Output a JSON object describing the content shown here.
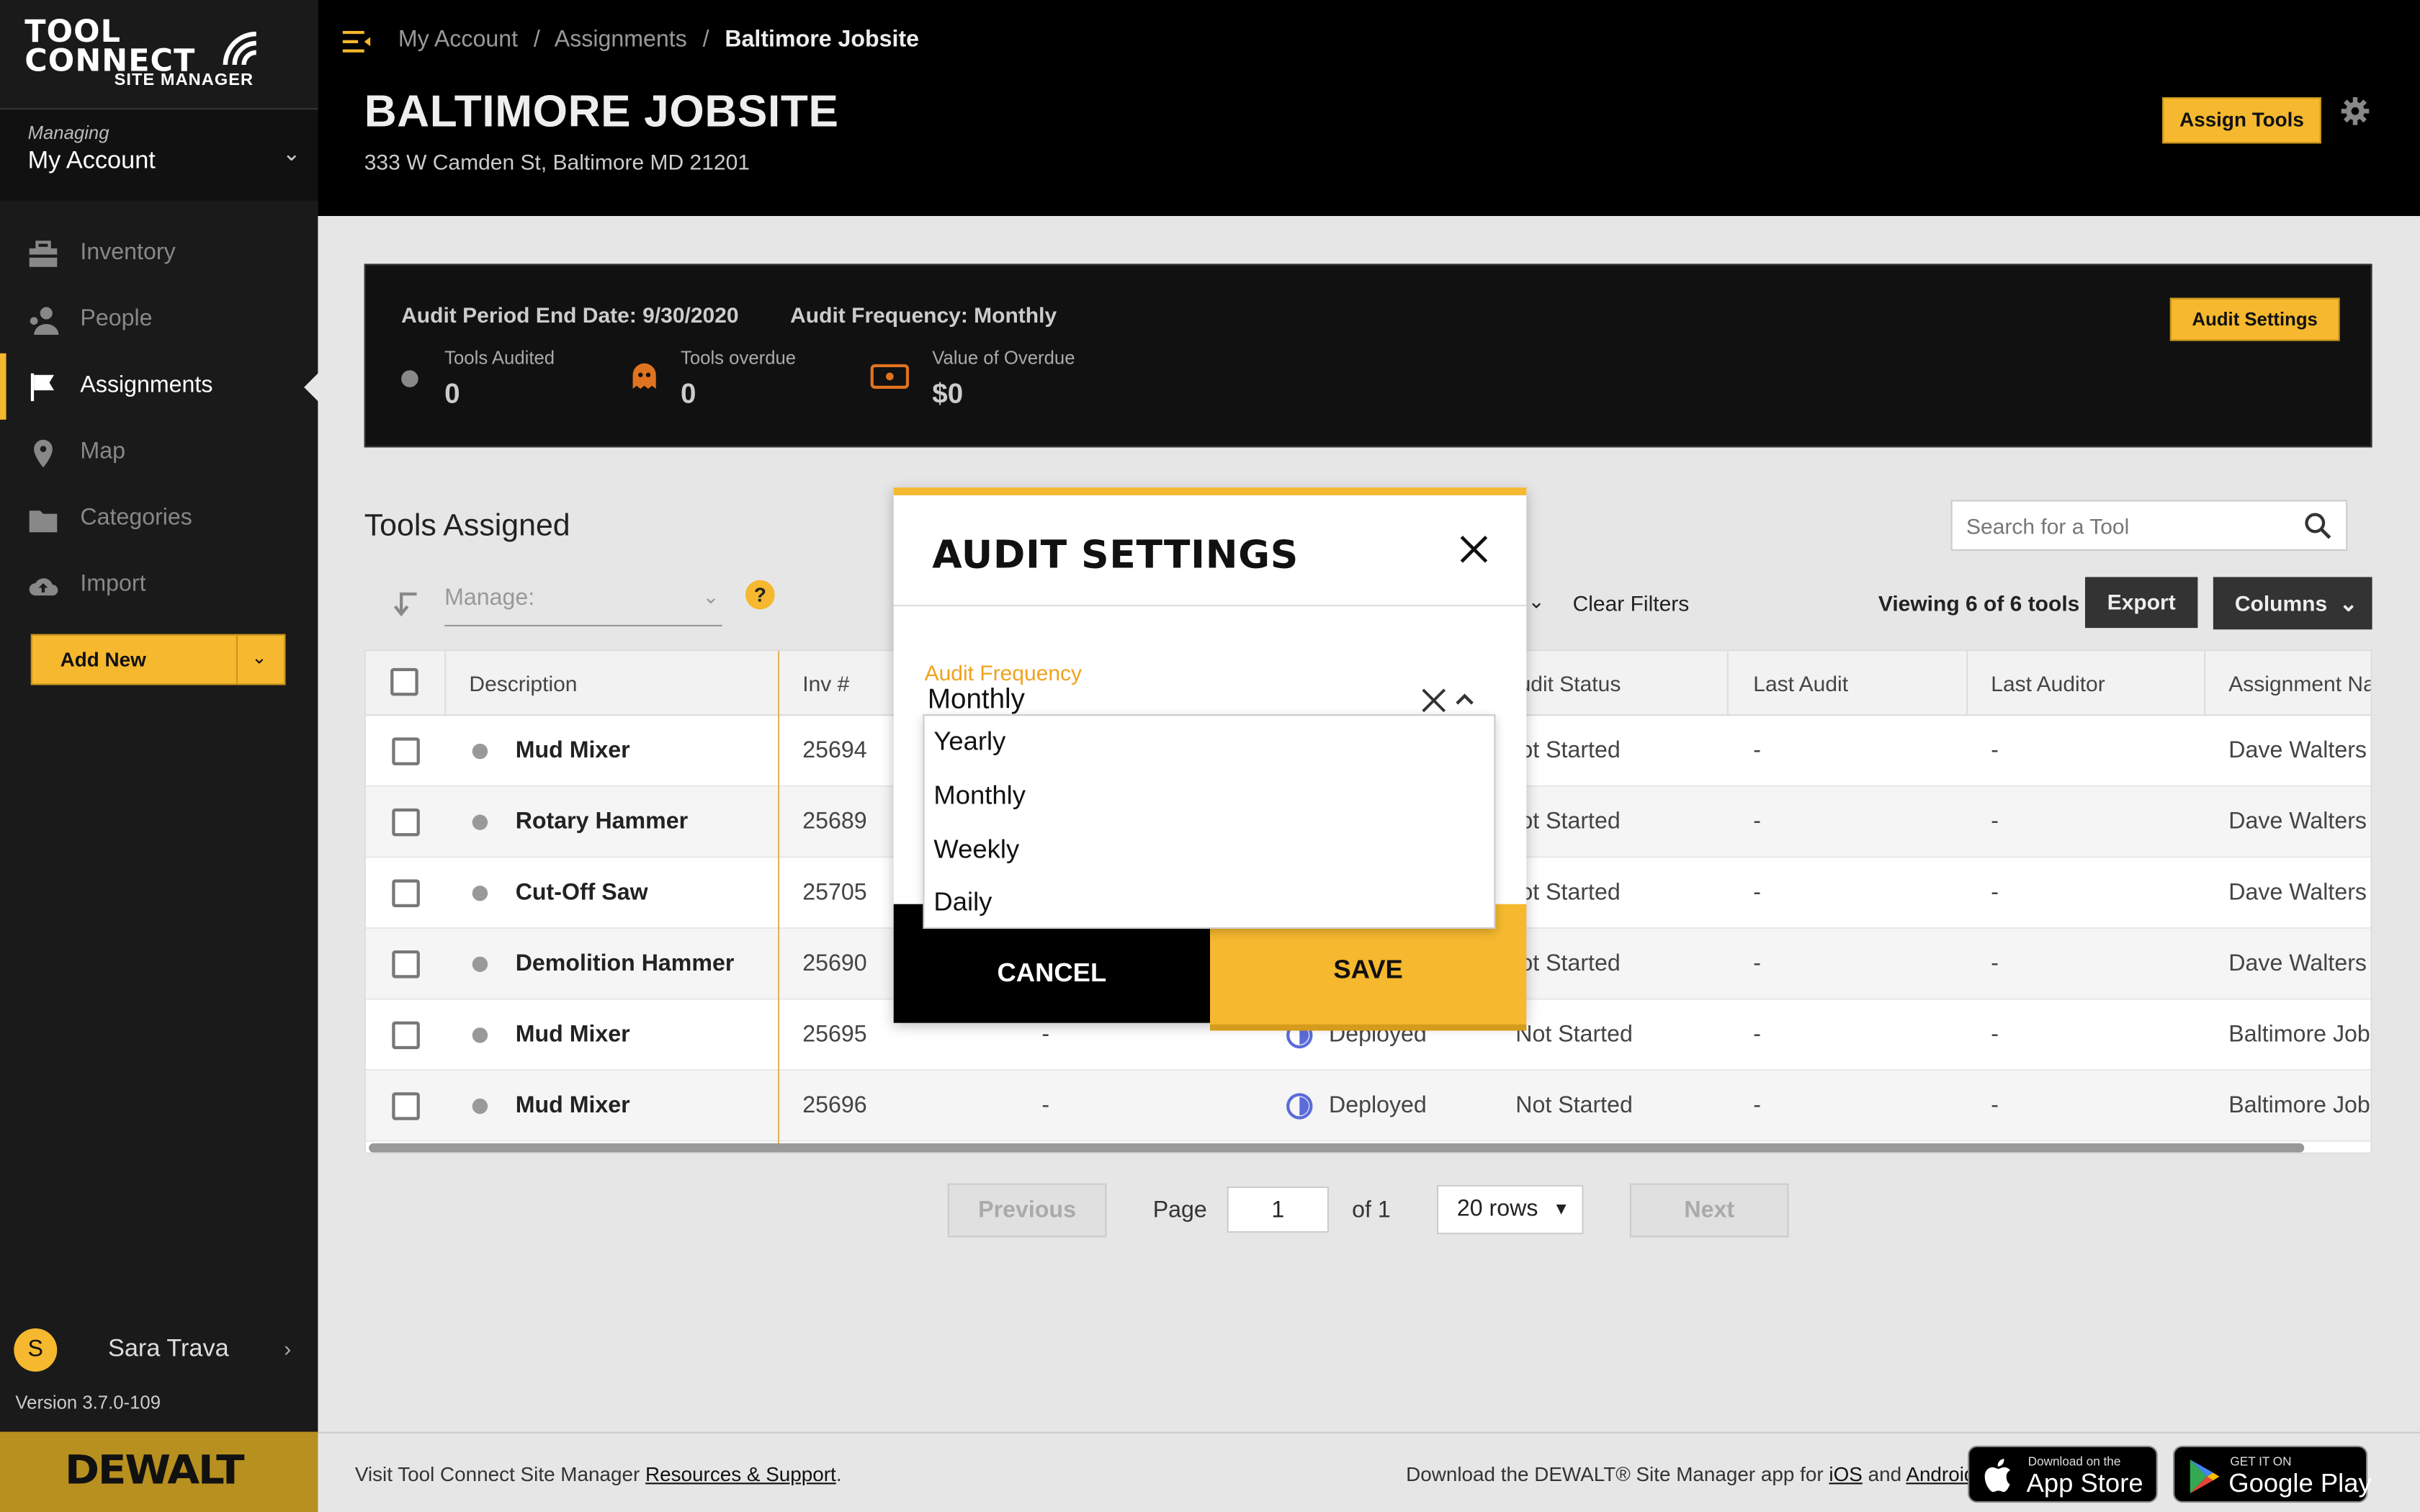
{
  "app": {
    "logo_line1": "TOOL",
    "logo_line2": "CONNECT",
    "logo_line3": "SITE MANAGER",
    "brand": "DEWALT",
    "accent_color": "#f5b82e"
  },
  "sidebar": {
    "managing_label": "Managing",
    "managing_value": "My Account",
    "items": [
      {
        "label": "Inventory",
        "icon": "toolbox-icon",
        "active": false
      },
      {
        "label": "People",
        "icon": "people-icon",
        "active": false
      },
      {
        "label": "Assignments",
        "icon": "flag-icon",
        "active": true
      },
      {
        "label": "Map",
        "icon": "map-pin-icon",
        "active": false
      },
      {
        "label": "Categories",
        "icon": "folder-icon",
        "active": false
      },
      {
        "label": "Import",
        "icon": "cloud-upload-icon",
        "active": false
      }
    ],
    "add_new_label": "Add New",
    "user_initial": "S",
    "user_name": "Sara Trava",
    "version": "Version 3.7.0-109"
  },
  "header": {
    "breadcrumbs": [
      "My Account",
      "Assignments",
      "Baltimore Jobsite"
    ],
    "breadcrumb_sep": "/",
    "title": "BALTIMORE JOBSITE",
    "address": "333 W Camden St, Baltimore MD 21201",
    "assign_tools_label": "Assign Tools"
  },
  "audit": {
    "period_end": "Audit Period End Date: 9/30/2020",
    "frequency": "Audit Frequency: Monthly",
    "settings_label": "Audit Settings",
    "stats": [
      {
        "label": "Tools Audited",
        "value": "0"
      },
      {
        "label": "Tools overdue",
        "value": "0"
      },
      {
        "label": "Value of Overdue",
        "value": "$0"
      }
    ]
  },
  "tools": {
    "heading": "Tools Assigned",
    "search_placeholder": "Search for a Tool",
    "manage_label": "Manage:",
    "help": "?",
    "clear_filters": "Clear Filters",
    "viewing": "Viewing 6 of 6 tools",
    "export_label": "Export",
    "columns_label": "Columns",
    "headers": [
      "Description",
      "Inv #",
      "udit Status",
      "Last Audit",
      "Last Auditor",
      "Assignment Nar"
    ],
    "rows": [
      {
        "desc": "Mud Mixer",
        "inv": "25694",
        "serial": "",
        "status": "",
        "audit": "Not Started",
        "last_audit": "-",
        "auditor": "-",
        "assign": "Dave Walters"
      },
      {
        "desc": "Rotary Hammer",
        "inv": "25689",
        "serial": "",
        "status": "",
        "audit": "Not Started",
        "last_audit": "-",
        "auditor": "-",
        "assign": "Dave Walters"
      },
      {
        "desc": "Cut-Off Saw",
        "inv": "25705",
        "serial": "",
        "status": "",
        "audit": "Not Started",
        "last_audit": "-",
        "auditor": "-",
        "assign": "Dave Walters"
      },
      {
        "desc": "Demolition Hammer",
        "inv": "25690",
        "serial": "",
        "status": "",
        "audit": "Not Started",
        "last_audit": "-",
        "auditor": "-",
        "assign": "Dave Walters"
      },
      {
        "desc": "Mud Mixer",
        "inv": "25695",
        "serial": "-",
        "status": "Deployed",
        "audit": "Not Started",
        "last_audit": "-",
        "auditor": "-",
        "assign": "Baltimore Jobs"
      },
      {
        "desc": "Mud Mixer",
        "inv": "25696",
        "serial": "-",
        "status": "Deployed",
        "audit": "Not Started",
        "last_audit": "-",
        "auditor": "-",
        "assign": "Baltimore Jobs"
      }
    ]
  },
  "pagination": {
    "previous": "Previous",
    "page_label": "Page",
    "page_value": "1",
    "of_label": "of 1",
    "rows_select": "20 rows",
    "next": "Next"
  },
  "footer": {
    "left_prefix": "Visit Tool Connect Site Manager",
    "left_link": "Resources & Support",
    "left_suffix": ".",
    "right_prefix": "Download the DEWALT® Site Manager app for",
    "ios_link": "iOS",
    "and": "and",
    "android_link": "Android",
    "appstore_small": "Download on the",
    "appstore_big": "App Store",
    "play_small": "GET IT ON",
    "play_big": "Google Play"
  },
  "modal": {
    "title": "AUDIT SETTINGS",
    "field_label": "Audit Frequency",
    "field_value": "Monthly",
    "options": [
      "Yearly",
      "Monthly",
      "Weekly",
      "Daily"
    ],
    "cancel_label": "CANCEL",
    "save_label": "SAVE"
  }
}
